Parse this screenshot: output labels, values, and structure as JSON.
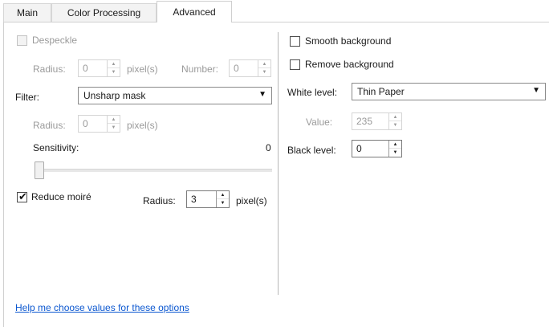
{
  "tabs": [
    {
      "label": "Main"
    },
    {
      "label": "Color Processing"
    },
    {
      "label": "Advanced"
    }
  ],
  "left": {
    "despeckle": {
      "label": "Despeckle",
      "checked": false,
      "enabled": false
    },
    "despeckle_radius": {
      "label": "Radius:",
      "value": "0",
      "unit": "pixel(s)"
    },
    "despeckle_number": {
      "label": "Number:",
      "value": "0"
    },
    "filter": {
      "label": "Filter:",
      "value": "Unsharp mask"
    },
    "filter_radius": {
      "label": "Radius:",
      "value": "0",
      "unit": "pixel(s)"
    },
    "sensitivity": {
      "label": "Sensitivity:",
      "value": "0",
      "level": 0
    },
    "reduce_moire": {
      "label": "Reduce moiré",
      "checked": true
    },
    "moire_radius": {
      "label": "Radius:",
      "value": "3",
      "unit": "pixel(s)"
    }
  },
  "right": {
    "smooth_background": {
      "label": "Smooth background",
      "checked": false
    },
    "remove_background": {
      "label": "Remove background",
      "checked": false
    },
    "white_level": {
      "label": "White level:",
      "value": "Thin Paper"
    },
    "white_value": {
      "label": "Value:",
      "value": "235"
    },
    "black_level": {
      "label": "Black level:",
      "value": "0"
    }
  },
  "help_link": "Help me choose values for these options",
  "icons": {
    "up": "▲",
    "down": "▼",
    "dropdown": "▼",
    "check": "✔"
  },
  "colors": {
    "link": "#0b57d0",
    "disabled_text": "#9a9a9a"
  }
}
